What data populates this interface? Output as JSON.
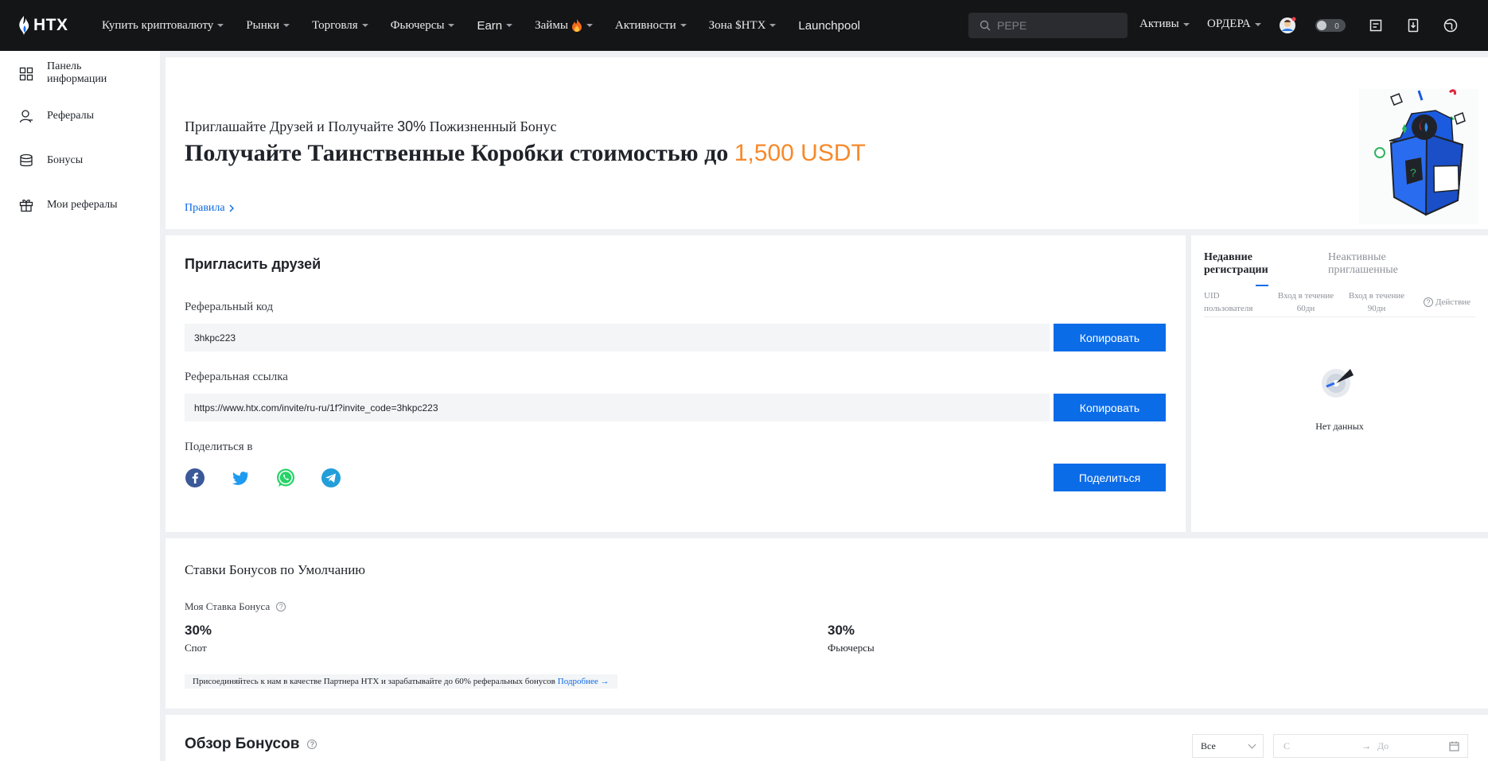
{
  "topbar": {
    "logo_text": "HTX",
    "nav": [
      {
        "label": "Купить криптовалюту",
        "caret": true
      },
      {
        "label": "Рынки",
        "caret": true
      },
      {
        "label": "Торговля",
        "caret": true
      },
      {
        "label": "Фьючерсы",
        "caret": true
      },
      {
        "label": "Earn",
        "caret": true
      },
      {
        "label": "Займы",
        "caret": true,
        "fire": true
      },
      {
        "label": "Активности",
        "caret": true
      },
      {
        "label": "Зона $HTX",
        "caret": true
      },
      {
        "label": "Launchpool",
        "caret": false
      }
    ],
    "search_placeholder": "PEPE",
    "assets_label": "Активы",
    "orders_label": "ОРДЕРА",
    "toggle_text": "0"
  },
  "sidebar": {
    "items": [
      {
        "label": "Панель информации",
        "icon": "dashboard-icon"
      },
      {
        "label": "Рефералы",
        "icon": "user-icon"
      },
      {
        "label": "Бонусы",
        "icon": "coins-icon"
      },
      {
        "label": "Мои рефералы",
        "icon": "gift-icon"
      }
    ]
  },
  "banner": {
    "subtitle_prefix": "Приглашайте Друзей и Получайте ",
    "subtitle_num": "30%",
    "subtitle_suffix": " Пожизненный Бонус",
    "headline": "Получайте Таинственные Коробки стоимостью до ",
    "headline_amount": "1,500 USDT",
    "rules_link": "Правила"
  },
  "invite": {
    "title": "Пригласить друзей",
    "code_label": "Реферальный код",
    "code_value": "3hkpc223",
    "copy_label": "Копировать",
    "link_label": "Реферальная ссылка",
    "link_value": "https://www.htx.com/invite/ru-ru/1f?invite_code=3hkpc223",
    "share_label": "Поделиться в",
    "share_button": "Поделиться",
    "social_icons": [
      "facebook-icon",
      "twitter-icon",
      "whatsapp-icon",
      "telegram-icon"
    ]
  },
  "recent": {
    "tab_active": "Недавние регистрации",
    "tab_inactive": "Неактивные приглашенные",
    "col_uid": "UID пользователя",
    "col_60": "Вход в течение 60дн",
    "col_90": "Вход в течение 90дн",
    "col_action": "Действие",
    "empty_text": "Нет данных"
  },
  "rates": {
    "title": "Ставки Бонусов по Умолчанию",
    "my_rate_label": "Моя Ставка Бонуса",
    "spot_value": "30%",
    "spot_label": "Спот",
    "futures_value": "30%",
    "futures_label": "Фьючерсы",
    "partner_text": "Присоединяйтесь к нам в качестве Партнера HTX и зарабатывайте до 60% реферальных бонусов",
    "partner_more": "Подробнее →"
  },
  "overview": {
    "title": "Обзор Бонусов",
    "filter_value": "Все",
    "date_from": "С",
    "date_to": "До"
  },
  "colors": {
    "accent": "#0b6ce8",
    "highlight": "#f7892b",
    "topbar": "#141517"
  }
}
